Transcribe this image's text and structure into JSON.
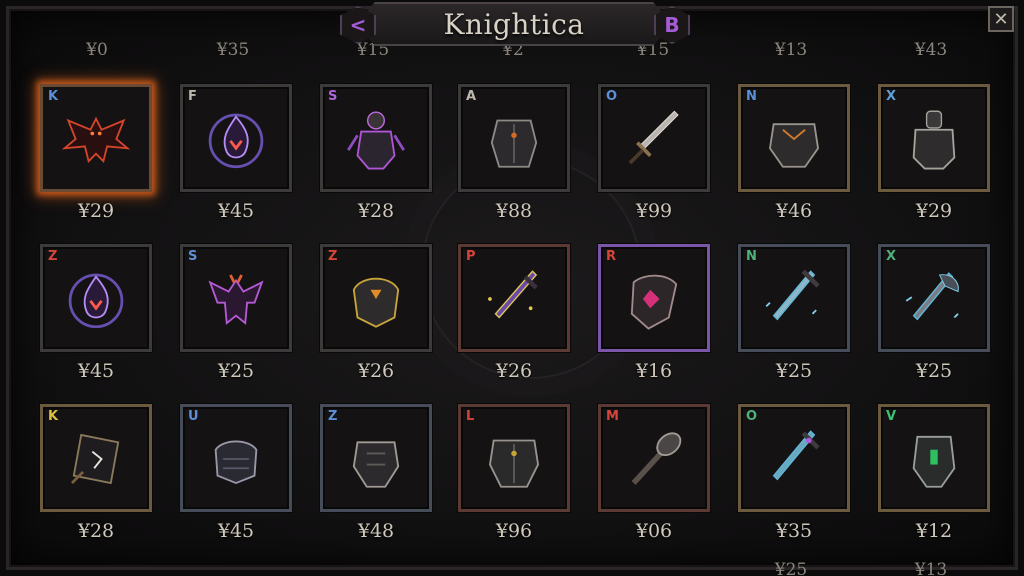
{
  "window": {
    "title": "Knightica",
    "prev_label": "<",
    "next_label": "B",
    "close_label": "✕"
  },
  "top_partial_prices": [
    "¥0",
    "¥35",
    "¥15",
    "¥2",
    "¥15",
    "¥13",
    "¥43"
  ],
  "bottom_partial_prices": [
    "",
    "",
    "",
    "",
    "",
    "¥25",
    "¥13"
  ],
  "rows": [
    [
      {
        "rune": "K",
        "price": "¥29",
        "icon": "demon-bat-icon"
      },
      {
        "rune": "F",
        "price": "¥45",
        "icon": "arcane-flame-icon"
      },
      {
        "rune": "S",
        "price": "¥28",
        "icon": "dark-knight-icon"
      },
      {
        "rune": "A",
        "price": "¥88",
        "icon": "plate-armor-icon"
      },
      {
        "rune": "O",
        "price": "¥99",
        "icon": "sword-icon"
      },
      {
        "rune": "N",
        "price": "¥46",
        "icon": "breastplate-icon"
      },
      {
        "rune": "X",
        "price": "¥29",
        "icon": "knight-armor-icon"
      }
    ],
    [
      {
        "rune": "Z",
        "price": "¥45",
        "icon": "arcane-flame-icon"
      },
      {
        "rune": "S",
        "price": "¥25",
        "icon": "imp-icon"
      },
      {
        "rune": "Z",
        "price": "¥26",
        "icon": "pauldron-icon"
      },
      {
        "rune": "P",
        "price": "¥26",
        "icon": "enchanted-sword-icon"
      },
      {
        "rune": "R",
        "price": "¥16",
        "icon": "shield-icon"
      },
      {
        "rune": "N",
        "price": "¥25",
        "icon": "frost-sword-icon"
      },
      {
        "rune": "X",
        "price": "¥25",
        "icon": "frost-axe-icon"
      }
    ],
    [
      {
        "rune": "K",
        "price": "¥28",
        "icon": "rune-tome-icon"
      },
      {
        "rune": "U",
        "price": "¥45",
        "icon": "gauntlet-icon"
      },
      {
        "rune": "Z",
        "price": "¥48",
        "icon": "chest-guard-icon"
      },
      {
        "rune": "L",
        "price": "¥96",
        "icon": "heavy-armor-icon"
      },
      {
        "rune": "M",
        "price": "¥06",
        "icon": "mace-icon"
      },
      {
        "rune": "O",
        "price": "¥35",
        "icon": "crystal-sword-icon"
      },
      {
        "rune": "V",
        "price": "¥12",
        "icon": "emerald-chestplate-icon"
      }
    ]
  ],
  "colors": {
    "accent_purple": "#a35bd6",
    "ember": "#c2541a",
    "frost": "#5fb7d6"
  }
}
